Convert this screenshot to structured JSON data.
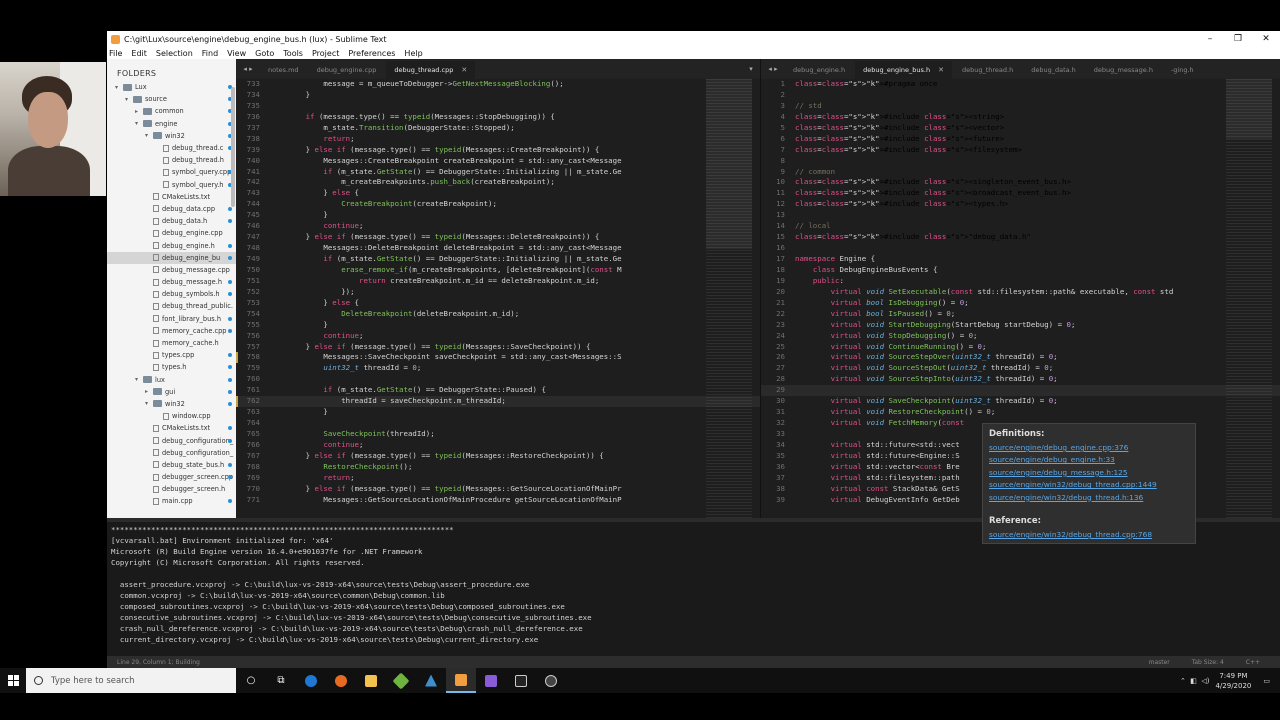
{
  "window": {
    "title": "C:\\git\\Lux\\source\\engine\\debug_engine_bus.h (lux) - Sublime Text",
    "controls": [
      "–",
      "❐",
      "✕"
    ]
  },
  "menu": [
    "File",
    "Edit",
    "Selection",
    "Find",
    "View",
    "Goto",
    "Tools",
    "Project",
    "Preferences",
    "Help"
  ],
  "sidebar": {
    "header": "FOLDERS",
    "items": [
      {
        "label": "Lux",
        "type": "folder",
        "depth": 0,
        "open": true
      },
      {
        "label": "source",
        "type": "folder",
        "depth": 1,
        "open": true
      },
      {
        "label": "common",
        "type": "folder",
        "depth": 2,
        "open": false
      },
      {
        "label": "engine",
        "type": "folder",
        "depth": 2,
        "open": true
      },
      {
        "label": "win32",
        "type": "folder",
        "depth": 3,
        "open": true
      },
      {
        "label": "debug_thread.c",
        "type": "file",
        "depth": 4
      },
      {
        "label": "debug_thread.h",
        "type": "file",
        "depth": 4
      },
      {
        "label": "symbol_query.cpp",
        "type": "file",
        "depth": 4
      },
      {
        "label": "symbol_query.h",
        "type": "file",
        "depth": 4
      },
      {
        "label": "CMakeLists.txt",
        "type": "file",
        "depth": 3
      },
      {
        "label": "debug_data.cpp",
        "type": "file",
        "depth": 3
      },
      {
        "label": "debug_data.h",
        "type": "file",
        "depth": 3
      },
      {
        "label": "debug_engine.cpp",
        "type": "file",
        "depth": 3
      },
      {
        "label": "debug_engine.h",
        "type": "file",
        "depth": 3
      },
      {
        "label": "debug_engine_bu",
        "type": "file",
        "depth": 3,
        "selected": true
      },
      {
        "label": "debug_message.cpp",
        "type": "file",
        "depth": 3
      },
      {
        "label": "debug_message.h",
        "type": "file",
        "depth": 3
      },
      {
        "label": "debug_symbols.h",
        "type": "file",
        "depth": 3
      },
      {
        "label": "debug_thread_public.",
        "type": "file",
        "depth": 3
      },
      {
        "label": "font_library_bus.h",
        "type": "file",
        "depth": 3
      },
      {
        "label": "memory_cache.cpp",
        "type": "file",
        "depth": 3
      },
      {
        "label": "memory_cache.h",
        "type": "file",
        "depth": 3
      },
      {
        "label": "types.cpp",
        "type": "file",
        "depth": 3
      },
      {
        "label": "types.h",
        "type": "file",
        "depth": 3
      },
      {
        "label": "lux",
        "type": "folder",
        "depth": 2,
        "open": true
      },
      {
        "label": "gui",
        "type": "folder",
        "depth": 3,
        "open": false
      },
      {
        "label": "win32",
        "type": "folder",
        "depth": 3,
        "open": true
      },
      {
        "label": "window.cpp",
        "type": "file",
        "depth": 4
      },
      {
        "label": "CMakeLists.txt",
        "type": "file",
        "depth": 3
      },
      {
        "label": "debug_configuration_",
        "type": "file",
        "depth": 3
      },
      {
        "label": "debug_configuration_",
        "type": "file",
        "depth": 3
      },
      {
        "label": "debug_state_bus.h",
        "type": "file",
        "depth": 3
      },
      {
        "label": "debugger_screen.cpp",
        "type": "file",
        "depth": 3
      },
      {
        "label": "debugger_screen.h",
        "type": "file",
        "depth": 3
      },
      {
        "label": "main.cpp",
        "type": "file",
        "depth": 3
      }
    ]
  },
  "left_pane": {
    "tabs": [
      {
        "label": "notes.md",
        "active": false
      },
      {
        "label": "debug_engine.cpp",
        "active": false
      },
      {
        "label": "debug_thread.cpp",
        "active": true
      }
    ],
    "lines": [
      {
        "n": "733",
        "code": "            message = m_queueToDebugger->GetNextMessageBlocking();"
      },
      {
        "n": "734",
        "code": "        }"
      },
      {
        "n": "735",
        "code": ""
      },
      {
        "n": "736",
        "code": "        if (message.type() == typeid(Messages::StopDebugging)) {"
      },
      {
        "n": "737",
        "code": "            m_state.Transition(DebuggerState::Stopped);"
      },
      {
        "n": "738",
        "code": "            return;"
      },
      {
        "n": "739",
        "code": "        } else if (message.type() == typeid(Messages::CreateBreakpoint)) {"
      },
      {
        "n": "740",
        "code": "            Messages::CreateBreakpoint createBreakpoint = std::any_cast<Message"
      },
      {
        "n": "741",
        "code": "            if (m_state.GetState() == DebuggerState::Initializing || m_state.Ge"
      },
      {
        "n": "742",
        "code": "                m_createBreakpoints.push_back(createBreakpoint);"
      },
      {
        "n": "743",
        "code": "            } else {"
      },
      {
        "n": "744",
        "code": "                CreateBreakpoint(createBreakpoint);"
      },
      {
        "n": "745",
        "code": "            }"
      },
      {
        "n": "746",
        "code": "            continue;"
      },
      {
        "n": "747",
        "code": "        } else if (message.type() == typeid(Messages::DeleteBreakpoint)) {"
      },
      {
        "n": "748",
        "code": "            Messages::DeleteBreakpoint deleteBreakpoint = std::any_cast<Message"
      },
      {
        "n": "749",
        "code": "            if (m_state.GetState() == DebuggerState::Initializing || m_state.Ge"
      },
      {
        "n": "750",
        "code": "                erase_remove_if(m_createBreakpoints, [deleteBreakpoint](const M"
      },
      {
        "n": "751",
        "code": "                    return createBreakpoint.m_id == deleteBreakpoint.m_id;"
      },
      {
        "n": "752",
        "code": "                });"
      },
      {
        "n": "753",
        "code": "            } else {"
      },
      {
        "n": "754",
        "code": "                DeleteBreakpoint(deleteBreakpoint.m_id);"
      },
      {
        "n": "755",
        "code": "            }"
      },
      {
        "n": "756",
        "code": "            continue;"
      },
      {
        "n": "757",
        "code": "        } else if (message.type() == typeid(Messages::SaveCheckpoint)) {"
      },
      {
        "n": "758",
        "code": "            Messages::SaveCheckpoint saveCheckpoint = std::any_cast<Messages::S"
      },
      {
        "n": "759",
        "code": "            uint32_t threadId = 0;"
      },
      {
        "n": "760",
        "code": ""
      },
      {
        "n": "761",
        "code": "            if (m_state.GetState() == DebuggerState::Paused) {"
      },
      {
        "n": "762",
        "code": "                threadId = saveCheckpoint.m_threadId;"
      },
      {
        "n": "763",
        "code": "            }"
      },
      {
        "n": "764",
        "code": ""
      },
      {
        "n": "765",
        "code": "            SaveCheckpoint(threadId);"
      },
      {
        "n": "766",
        "code": "            continue;"
      },
      {
        "n": "767",
        "code": "        } else if (message.type() == typeid(Messages::RestoreCheckpoint)) {"
      },
      {
        "n": "768",
        "code": "            RestoreCheckpoint();"
      },
      {
        "n": "769",
        "code": "            return;"
      },
      {
        "n": "770",
        "code": "        } else if (message.type() == typeid(Messages::GetSourceLocationOfMainPr"
      },
      {
        "n": "771",
        "code": "            Messages::GetSourceLocationOfMainProcedure getSourceLocationOfMainP"
      }
    ]
  },
  "right_pane": {
    "tabs": [
      {
        "label": "debug_engine.h",
        "active": false
      },
      {
        "label": "debug_engine_bus.h",
        "active": true
      },
      {
        "label": "debug_thread.h",
        "active": false
      },
      {
        "label": "debug_data.h",
        "active": false
      },
      {
        "label": "debug_message.h",
        "active": false
      },
      {
        "label": "-ging.h",
        "active": false
      }
    ],
    "lines": [
      {
        "n": "1",
        "code": "#pragma once"
      },
      {
        "n": "2",
        "code": ""
      },
      {
        "n": "3",
        "code": "// std"
      },
      {
        "n": "4",
        "code": "#include <string>"
      },
      {
        "n": "5",
        "code": "#include <vector>"
      },
      {
        "n": "6",
        "code": "#include <future>"
      },
      {
        "n": "7",
        "code": "#include <filesystem>"
      },
      {
        "n": "8",
        "code": ""
      },
      {
        "n": "9",
        "code": "// common"
      },
      {
        "n": "10",
        "code": "#include <singleton_event_bus.h>"
      },
      {
        "n": "11",
        "code": "#include <broadcast_event_bus.h>"
      },
      {
        "n": "12",
        "code": "#include <types.h>"
      },
      {
        "n": "13",
        "code": ""
      },
      {
        "n": "14",
        "code": "// local"
      },
      {
        "n": "15",
        "code": "#include \"debug_data.h\""
      },
      {
        "n": "16",
        "code": ""
      },
      {
        "n": "17",
        "code": "namespace Engine {"
      },
      {
        "n": "18",
        "code": "    class DebugEngineBusEvents {"
      },
      {
        "n": "19",
        "code": "    public:"
      },
      {
        "n": "20",
        "code": "        virtual void SetExecutable(const std::filesystem::path& executable, const std"
      },
      {
        "n": "21",
        "code": "        virtual bool IsDebugging() = 0;"
      },
      {
        "n": "22",
        "code": "        virtual bool IsPaused() = 0;"
      },
      {
        "n": "23",
        "code": "        virtual void StartDebugging(StartDebug startDebug) = 0;"
      },
      {
        "n": "24",
        "code": "        virtual void StopDebugging() = 0;"
      },
      {
        "n": "25",
        "code": "        virtual void ContinueRunning() = 0;"
      },
      {
        "n": "26",
        "code": "        virtual void SourceStepOver(uint32_t threadId) = 0;"
      },
      {
        "n": "27",
        "code": "        virtual void SourceStepOut(uint32_t threadId) = 0;"
      },
      {
        "n": "28",
        "code": "        virtual void SourceStepInto(uint32_t threadId) = 0;"
      },
      {
        "n": "29",
        "code": ""
      },
      {
        "n": "30",
        "code": "        virtual void SaveCheckpoint(uint32_t threadId) = 0;"
      },
      {
        "n": "31",
        "code": "        virtual void RestoreCheckpoint() = 0;"
      },
      {
        "n": "32",
        "code": "        virtual void FetchMemory(const"
      },
      {
        "n": "33",
        "code": ""
      },
      {
        "n": "34",
        "code": "        virtual std::future<std::vect                                  iles() ="
      },
      {
        "n": "35",
        "code": "        virtual std::future<Engine::S                                  rocedure("
      },
      {
        "n": "36",
        "code": "        virtual std::vector<const Bre                                  ointers"
      },
      {
        "n": "37",
        "code": "        virtual std::filesystem::path"
      },
      {
        "n": "38",
        "code": "        virtual const StackData& GetS"
      },
      {
        "n": "39",
        "code": "        virtual DebugEventInfo GetDeb"
      }
    ]
  },
  "popup": {
    "definitions_label": "Definitions:",
    "definitions": [
      "source/engine/debug_engine.cpp:376",
      "source/engine/debug_engine.h:33",
      "source/engine/debug_message.h:125",
      "source/engine/win32/debug_thread.cpp:1449",
      "source/engine/win32/debug_thread.h:136"
    ],
    "reference_label": "Reference:",
    "references": [
      "source/engine/win32/debug_thread.cpp:768"
    ]
  },
  "output": [
    "*****************************************************************************",
    "[vcvarsall.bat] Environment initialized for: 'x64'",
    "Microsoft (R) Build Engine version 16.4.0+e901037fe for .NET Framework",
    "Copyright (C) Microsoft Corporation. All rights reserved.",
    "",
    "  assert_procedure.vcxproj -> C:\\build\\lux-vs-2019-x64\\source\\tests\\Debug\\assert_procedure.exe",
    "  common.vcxproj -> C:\\build\\lux-vs-2019-x64\\source\\common\\Debug\\common.lib",
    "  composed_subroutines.vcxproj -> C:\\build\\lux-vs-2019-x64\\source\\tests\\Debug\\composed_subroutines.exe",
    "  consecutive_subroutines.vcxproj -> C:\\build\\lux-vs-2019-x64\\source\\tests\\Debug\\consecutive_subroutines.exe",
    "  crash_null_dereference.vcxproj -> C:\\build\\lux-vs-2019-x64\\source\\tests\\Debug\\crash_null_dereference.exe",
    "  current_directory.vcxproj -> C:\\build\\lux-vs-2019-x64\\source\\tests\\Debug\\current_directory.exe"
  ],
  "status": {
    "left": "Line 29, Column 1; Building",
    "branch": "master",
    "tab_size": "Tab Size: 4",
    "syntax": "C++"
  },
  "taskbar": {
    "search_placeholder": "Type here to search",
    "time": "7:49 PM",
    "date": "4/29/2020"
  }
}
